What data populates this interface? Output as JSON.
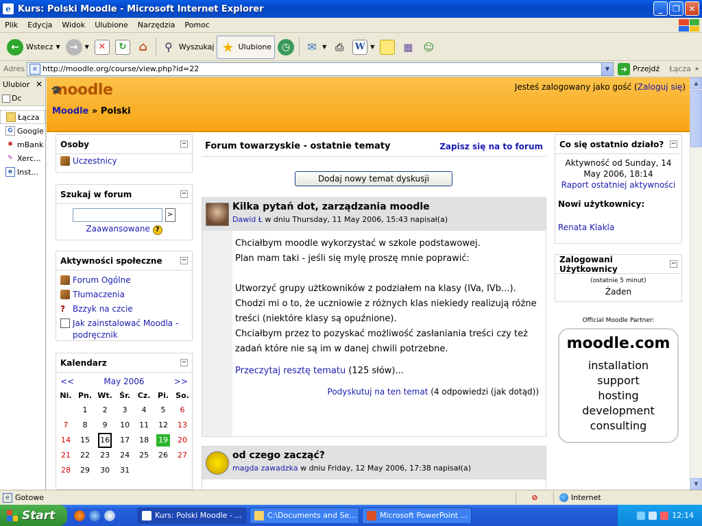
{
  "window": {
    "title": "Kurs: Polski Moodle - Microsoft Internet Explorer",
    "minimize": "_",
    "maximize": "❐",
    "close": "✕"
  },
  "menu": [
    "Plik",
    "Edycja",
    "Widok",
    "Ulubione",
    "Narzędzia",
    "Pomoc"
  ],
  "toolbar": {
    "back_label": "Wstecz",
    "search_label": "Wyszukaj",
    "favorites_label": "Ulubione"
  },
  "address": {
    "label": "Adres",
    "url": "http://moodle.org/course/view.php?id=22",
    "go_label": "Przejdź",
    "links_label": "Łącza"
  },
  "favorites": {
    "title": "Ulubior",
    "add_label": "Dc",
    "items": [
      {
        "label": "Łącza",
        "icon": "folder-icon"
      },
      {
        "label": "Google",
        "icon": "google-icon"
      },
      {
        "label": "mBank",
        "icon": "mbank-icon"
      },
      {
        "label": "Xerc...",
        "icon": "feather-icon"
      },
      {
        "label": "Inst...",
        "icon": "ie-page-icon"
      }
    ]
  },
  "header": {
    "logo": "moodle",
    "login_text": "Jesteś zalogowany jako gość (",
    "login_link": "Zaloguj się",
    "login_close": ")",
    "crumb_home": "Moodle",
    "crumb_sep": "»",
    "crumb_current": "Polski"
  },
  "blocks": {
    "people": {
      "title": "Osoby",
      "items": [
        "Uczestnicy"
      ]
    },
    "search": {
      "title": "Szukaj w forum",
      "go": ">",
      "advanced": "Zaawansowane",
      "help": "?"
    },
    "social": {
      "title": "Aktywności społeczne",
      "items": [
        "Forum Ogólne",
        "Tłumaczenia",
        "Bzzyk na czcie",
        "Jak zainstalować Moodla - podręcznik"
      ]
    },
    "calendar": {
      "title": "Kalendarz",
      "prev": "<<",
      "next": ">>",
      "month": "May 2006",
      "weekdays": [
        "Ni.",
        "Pn.",
        "Wt.",
        "Śr.",
        "Cz.",
        "Pi.",
        "So."
      ],
      "weeks": [
        [
          "",
          "1",
          "2",
          "3",
          "4",
          "5",
          "6"
        ],
        [
          "7",
          "8",
          "9",
          "10",
          "11",
          "12",
          "13"
        ],
        [
          "14",
          "15",
          "16",
          "17",
          "18",
          "19",
          "20"
        ],
        [
          "21",
          "22",
          "23",
          "24",
          "25",
          "26",
          "27"
        ],
        [
          "28",
          "29",
          "30",
          "31",
          "",
          "",
          ""
        ]
      ],
      "today": "16",
      "event_day": "19"
    },
    "recent": {
      "title": "Co się ostatnio działo?",
      "activity": "Aktywność od Sunday, 14 May 2006, 18:14",
      "report_link": "Raport ostatniej aktywności",
      "new_users_title": "Nowi użytkownicy:",
      "new_user": "Renata Klakla"
    },
    "online": {
      "title": "Zalogowani Użytkownicy",
      "note": "(ostatnie 5 minut)",
      "value": "Żaden"
    },
    "partner": {
      "label": "Official Moodle Partner:",
      "brand": "moodle.com",
      "lines": [
        "installation",
        "support",
        "hosting",
        "development",
        "consulting"
      ]
    }
  },
  "forum": {
    "title": "Forum towarzyskie - ostatnie tematy",
    "subscribe": "Zapisz się na to forum",
    "add_button": "Dodaj nowy temat dyskusji",
    "posts": [
      {
        "subject": "Kilka pytań dot, zarządzania moodle",
        "author": "Dawid Ł",
        "meta": " w dniu Thursday, 11 May 2006, 15:43 napisał(a)",
        "body": [
          "Chciałbym moodle wykorzystać w szkole podstawowej.",
          "Plan mam taki - jeśli się mylę proszę mnie poprawić:",
          "",
          "Utworzyć grupy użtkowników z podziałem na klasy (IVa, IVb...).",
          "Chodzi mi o to, że uczniowie z różnych klas niekiedy realizują różne treści (niektóre klasy są opuźnione).",
          "Chciałbym przez to pozyskać możliwość zasłaniania treści czy też zadań które nie są im w danej chwili potrzebne."
        ],
        "read_more": "Przeczytaj resztę tematu",
        "word_count": " (125 słów)...",
        "discuss": "Podyskutuj na ten temat",
        "replies": " (4 odpowiedzi (jak dotąd))"
      },
      {
        "subject": "od czego zacząć?",
        "author": "magda zawadzka",
        "meta": " w dniu Friday, 12 May 2006, 17:38 napisał(a)"
      }
    ]
  },
  "status": {
    "text": "Gotowe",
    "zone": "Internet"
  },
  "taskbar": {
    "start": "Start",
    "tasks": [
      "Kurs: Polski Moodle - ...",
      "C:\\Documents and Se...",
      "Microsoft PowerPoint ..."
    ],
    "clock": "12:14"
  }
}
